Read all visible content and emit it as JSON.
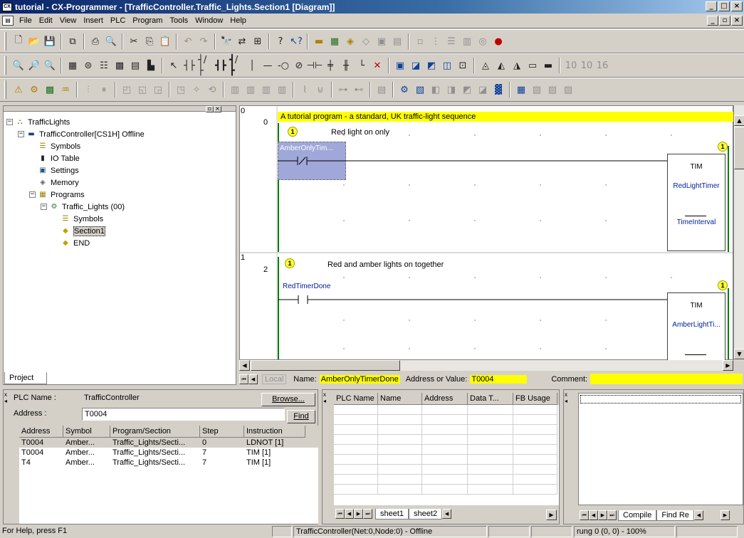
{
  "window": {
    "title": "tutorial - CX-Programmer - [TrafficController.Traffic_Lights.Section1 [Diagram]]",
    "app_icon_text": "CX"
  },
  "menu": [
    "File",
    "Edit",
    "View",
    "Insert",
    "PLC",
    "Program",
    "Tools",
    "Window",
    "Help"
  ],
  "project_tree": {
    "tab_label": "Project",
    "items": [
      {
        "label": "TrafficLights",
        "indent": 0,
        "icon": "network-icon",
        "expander": "−"
      },
      {
        "label": "TrafficController[CS1H] Offline",
        "indent": 1,
        "icon": "plc-icon",
        "expander": "−"
      },
      {
        "label": "Symbols",
        "indent": 2,
        "icon": "symbols-icon"
      },
      {
        "label": "IO Table",
        "indent": 2,
        "icon": "io-table-icon"
      },
      {
        "label": "Settings",
        "indent": 2,
        "icon": "settings-icon"
      },
      {
        "label": "Memory",
        "indent": 2,
        "icon": "memory-icon"
      },
      {
        "label": "Programs",
        "indent": 2,
        "icon": "programs-icon",
        "expander": "−"
      },
      {
        "label": "Traffic_Lights (00)",
        "indent": 3,
        "icon": "program-icon",
        "expander": "−"
      },
      {
        "label": "Symbols",
        "indent": 4,
        "icon": "symbols-icon"
      },
      {
        "label": "Section1",
        "indent": 4,
        "icon": "section-icon",
        "selected": true
      },
      {
        "label": "END",
        "indent": 4,
        "icon": "section-icon"
      }
    ]
  },
  "diagram": {
    "rung_marker_0": "0",
    "rung_marker_1": "1",
    "comment": "A tutorial program - a standard, UK traffic-light sequence",
    "rung0": {
      "step": "0",
      "badge": "1",
      "comment": "Red light on only",
      "contact_label": "AmberOnlyTim...",
      "block": {
        "name": "TIM",
        "operand": "RedLightTimer",
        "set": "TimeInterval"
      }
    },
    "rung1": {
      "step": "2",
      "badge": "1",
      "comment": "Red and amber lights on together",
      "contact_label": "RedTimerDone",
      "block": {
        "name": "TIM",
        "operand": "AmberLightTi..."
      }
    }
  },
  "infobar": {
    "local": "Local",
    "name_label": "Name:",
    "name_value": "AmberOnlyTimerDone",
    "addr_label": "Address or Value:",
    "addr_value": "T0004",
    "comment_label": "Comment:"
  },
  "crossref": {
    "plc_label": "PLC Name :",
    "plc_value": "TrafficController",
    "browse": "Browse...",
    "addr_label": "Address :",
    "addr_value": "T0004",
    "find": "Find",
    "columns": [
      "Address",
      "Symbol",
      "Program/Section",
      "Step",
      "Instruction"
    ],
    "rows": [
      [
        "T0004",
        "Amber...",
        "Traffic_Lights/Secti...",
        "0",
        "LDNOT [1]"
      ],
      [
        "T0004",
        "Amber...",
        "Traffic_Lights/Secti...",
        "7",
        "TIM [1]"
      ],
      [
        "T4",
        "Amber...",
        "Traffic_Lights/Secti...",
        "7",
        "TIM [1]"
      ]
    ]
  },
  "watch": {
    "columns": [
      "PLC Name",
      "Name",
      "Address",
      "Data T...",
      "FB Usage"
    ],
    "tabs": [
      "sheet1",
      "sheet2"
    ]
  },
  "output": {
    "tabs": [
      "Compile",
      "Find Re"
    ]
  },
  "status": {
    "help": "For Help, press F1",
    "plc": "TrafficController(Net:0,Node:0) - Offline",
    "rung": "rung 0 (0, 0) - 100%"
  }
}
